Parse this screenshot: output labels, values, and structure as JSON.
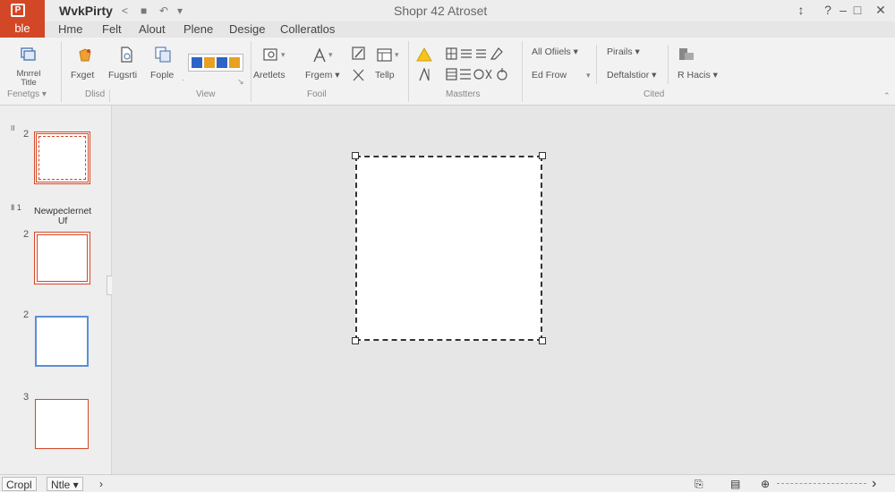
{
  "titlebar": {
    "logo_glyph": "P",
    "app_name": "WvkPirty",
    "doc_title": "Shopr 42 Atroset",
    "qat": [
      "<",
      "■",
      "↶",
      "▾"
    ],
    "window_controls": [
      "↕",
      "?",
      "–",
      "□",
      "✕"
    ]
  },
  "tabs": {
    "file": "ble",
    "items": [
      "Hme",
      "Felt",
      "Alout",
      "Plene",
      "Desige",
      "Colleratlos"
    ]
  },
  "ribbon": {
    "groups": {
      "first": {
        "label": "Fenetgs ▾",
        "buttons": {
          "main": "Mnrrel\nTitle"
        }
      },
      "clipboard": {
        "label": "Dlisd",
        "buttons": [
          "Fxget",
          "Fugsrti",
          "Fople"
        ]
      },
      "view": {
        "label": "View"
      },
      "tools": {
        "label": "Fooil",
        "buttons": [
          "Aretlets",
          "Frgem ▾",
          "Tellp"
        ]
      },
      "masters": {
        "label": "Mastters"
      },
      "arrange": {
        "label": "Cited",
        "items": [
          "All Ofiiels ▾",
          "Ed Frow",
          "Pirails ▾",
          "Deftalstior ▾",
          "R Hacis ▾"
        ]
      }
    },
    "swatch_colors": [
      "#2e64c8",
      "#e8a020",
      "#2e64c8",
      "#e8a020"
    ]
  },
  "slide_panel": {
    "thumbs": [
      {
        "num": "2",
        "marker": "II",
        "style": "dashed-red"
      },
      {
        "num": "2",
        "marker": "Ⅱ 1",
        "section": "Newpeclernet\nUf",
        "style": "double-red"
      },
      {
        "num": "2",
        "style": "blue"
      },
      {
        "num": "3",
        "style": "red"
      }
    ]
  },
  "statusbar": {
    "left_button": "Cropl",
    "notes_button": "Ntle ▾",
    "arrow": "›",
    "right_icons": [
      "⎘",
      "▤",
      "⊕"
    ],
    "next": "›"
  },
  "colors": {
    "accent": "#d24726",
    "thumb_blue": "#5b8fd6"
  }
}
